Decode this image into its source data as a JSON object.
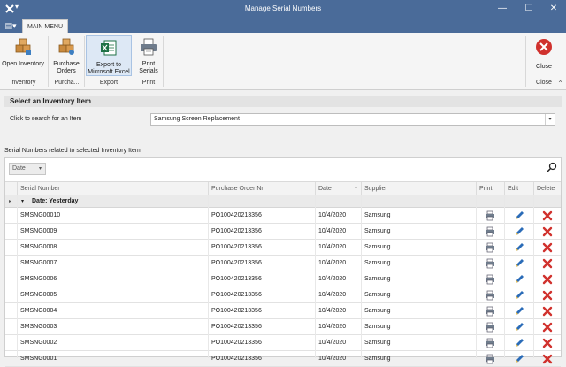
{
  "window": {
    "title": "Manage Serial Numbers",
    "quick_access": "▾",
    "minimize": "—",
    "maximize": "☐",
    "close": "✕"
  },
  "tabs": {
    "menu_icon": "▤▾",
    "main_menu": "MAIN MENU"
  },
  "ribbon": {
    "open_inventory": "Open Inventory",
    "purchase_orders_1": "Purchase",
    "purchase_orders_2": "Orders",
    "export_1": "Export to",
    "export_2": "Microsoft Excel",
    "print_1": "Print",
    "print_2": "Serials",
    "close": "Close",
    "group_inventory": "Inventory",
    "group_purchase": "Purcha...",
    "group_export": "Export",
    "group_print": "Print",
    "group_close": "Close",
    "collapse": "⌃"
  },
  "select_item": {
    "section_title": "Select an Inventory Item",
    "search_label": "Click to search for an Item",
    "search_value": "Samsung Screen Replacement",
    "dropdown_icon": "▾"
  },
  "serials": {
    "list_title": "Serial Numbers related to selected Inventory Item",
    "group_by": "Date",
    "group_by_arrow": "▾",
    "columns": {
      "serial": "Serial Number",
      "po": "Purchase Order Nr.",
      "date": "Date",
      "date_sort": "▾",
      "supplier": "Supplier",
      "print": "Print",
      "edit": "Edit",
      "delete": "Delete"
    },
    "group_row": "Date: Yesterday",
    "group_expander": "▾",
    "row_indicator": "▸",
    "rows": [
      {
        "serial": "SMSNG00010",
        "po": "PO100420213356",
        "date": "10/4/2020",
        "supplier": "Samsung"
      },
      {
        "serial": "SMSNG0009",
        "po": "PO100420213356",
        "date": "10/4/2020",
        "supplier": "Samsung"
      },
      {
        "serial": "SMSNG0008",
        "po": "PO100420213356",
        "date": "10/4/2020",
        "supplier": "Samsung"
      },
      {
        "serial": "SMSNG0007",
        "po": "PO100420213356",
        "date": "10/4/2020",
        "supplier": "Samsung"
      },
      {
        "serial": "SMSNG0006",
        "po": "PO100420213356",
        "date": "10/4/2020",
        "supplier": "Samsung"
      },
      {
        "serial": "SMSNG0005",
        "po": "PO100420213356",
        "date": "10/4/2020",
        "supplier": "Samsung"
      },
      {
        "serial": "SMSNG0004",
        "po": "PO100420213356",
        "date": "10/4/2020",
        "supplier": "Samsung"
      },
      {
        "serial": "SMSNG0003",
        "po": "PO100420213356",
        "date": "10/4/2020",
        "supplier": "Samsung"
      },
      {
        "serial": "SMSNG0002",
        "po": "PO100420213356",
        "date": "10/4/2020",
        "supplier": "Samsung"
      },
      {
        "serial": "SMSNG0001",
        "po": "PO100420213356",
        "date": "10/4/2020",
        "supplier": "Samsung"
      }
    ]
  },
  "colors": {
    "titlebar": "#4a6b99",
    "edit_icon": "#2b6cb8",
    "delete_icon": "#d0312d"
  }
}
